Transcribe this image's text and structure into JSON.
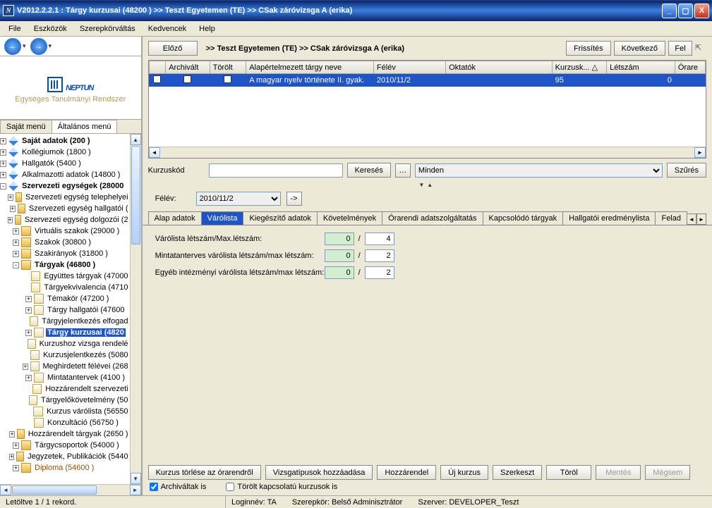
{
  "window": {
    "title": "V2012.2.2.1 : Tárgy kurzusai (48200  )  >> Teszt Egyetemen (TE) >> CSak záróvizsga A (erika)"
  },
  "menu": {
    "items": [
      "File",
      "Eszközök",
      "Szerepkörváltás",
      "Kedvencek",
      "Help"
    ]
  },
  "logo": {
    "main": "NEPTUN",
    "sub": "Egységes Tanulmányi Rendszer"
  },
  "leftTabs": {
    "t0": "Saját menü",
    "t1": "Általános menü"
  },
  "tree": [
    {
      "lvl": 0,
      "tw": "+",
      "ic": "d",
      "lbl": "Saját adatok (200  )",
      "bold": true
    },
    {
      "lvl": 0,
      "tw": "+",
      "ic": "d",
      "lbl": "Kollégiumok (1800  )"
    },
    {
      "lvl": 0,
      "tw": "+",
      "ic": "d",
      "lbl": "Hallgatók (5400  )"
    },
    {
      "lvl": 0,
      "tw": "+",
      "ic": "d",
      "lbl": "Alkalmazotti adatok (14800  )"
    },
    {
      "lvl": 0,
      "tw": "-",
      "ic": "d",
      "lbl": "Szervezeti egységek (28000",
      "bold": true
    },
    {
      "lvl": 1,
      "tw": "+",
      "ic": "f",
      "lbl": "Szervezeti egység telephelyei"
    },
    {
      "lvl": 1,
      "tw": "+",
      "ic": "f",
      "lbl": "Szervezeti egység hallgatói ("
    },
    {
      "lvl": 1,
      "tw": "+",
      "ic": "f",
      "lbl": "Szervezeti egység dolgozói (2"
    },
    {
      "lvl": 1,
      "tw": "+",
      "ic": "f",
      "lbl": "Virtuális szakok (29000  )"
    },
    {
      "lvl": 1,
      "tw": "+",
      "ic": "f",
      "lbl": "Szakok (30800  )"
    },
    {
      "lvl": 1,
      "tw": "+",
      "ic": "f",
      "lbl": "Szakirányok (31800  )"
    },
    {
      "lvl": 1,
      "tw": "-",
      "ic": "f",
      "lbl": "Tárgyak (46800  )",
      "bold": true
    },
    {
      "lvl": 2,
      "tw": " ",
      "ic": "p",
      "lbl": "Együttes tárgyak (47000"
    },
    {
      "lvl": 2,
      "tw": " ",
      "ic": "p",
      "lbl": "Tárgyekvivalencia (4710"
    },
    {
      "lvl": 2,
      "tw": "+",
      "ic": "p",
      "lbl": "Témakör (47200  )"
    },
    {
      "lvl": 2,
      "tw": "+",
      "ic": "p",
      "lbl": "Tárgy hallgatói (47600  "
    },
    {
      "lvl": 2,
      "tw": " ",
      "ic": "p",
      "lbl": "Tárgyjelentkezés elfogad"
    },
    {
      "lvl": 2,
      "tw": "+",
      "ic": "p",
      "lbl": "Tárgy kurzusai (4820",
      "sel": true,
      "bold": true
    },
    {
      "lvl": 2,
      "tw": " ",
      "ic": "p",
      "lbl": "Kurzushoz vizsga rendelé"
    },
    {
      "lvl": 2,
      "tw": " ",
      "ic": "p",
      "lbl": "Kurzusjelentkezés (5080"
    },
    {
      "lvl": 2,
      "tw": "+",
      "ic": "p",
      "lbl": "Meghirdetett félévei (268"
    },
    {
      "lvl": 2,
      "tw": "+",
      "ic": "p",
      "lbl": "Mintatantervek (4100  )"
    },
    {
      "lvl": 2,
      "tw": " ",
      "ic": "p",
      "lbl": "Hozzárendelt szervezeti "
    },
    {
      "lvl": 2,
      "tw": " ",
      "ic": "p",
      "lbl": "Tárgyelőkövetelmény (50"
    },
    {
      "lvl": 2,
      "tw": " ",
      "ic": "p",
      "lbl": "Kurzus várólista (56550  "
    },
    {
      "lvl": 2,
      "tw": " ",
      "ic": "p",
      "lbl": "Konzultáció (56750  )"
    },
    {
      "lvl": 1,
      "tw": "+",
      "ic": "f",
      "lbl": "Hozzárendelt tárgyak (2650  )"
    },
    {
      "lvl": 1,
      "tw": "+",
      "ic": "f",
      "lbl": "Tárgycsoportok (54000  )"
    },
    {
      "lvl": 1,
      "tw": "+",
      "ic": "f",
      "lbl": "Jegyzetek, Publikációk (5440"
    },
    {
      "lvl": 1,
      "tw": "+",
      "ic": "f",
      "lbl": "Diploma (54600  )",
      "brown": true
    }
  ],
  "header": {
    "prev": "Előző",
    "breadcrumb": ">> Teszt Egyetemen (TE) >> CSak záróvizsga A (erika)",
    "refresh": "Frissítés",
    "next": "Következő",
    "up": "Fel"
  },
  "grid": {
    "cols": [
      "",
      "Archivált",
      "Törölt",
      "Alapértelmezett tárgy neve",
      "Félév",
      "Oktatók",
      "Kurzusk... △",
      "Létszám",
      "Órare"
    ],
    "row": {
      "c3": "A magyar nyelv története II. gyak.",
      "c4": "2010/11/2",
      "c5": "",
      "c6": "95",
      "c7": "0"
    }
  },
  "search": {
    "label": "Kurzuskód",
    "btn": "Keresés",
    "filter": "Minden",
    "filterBtn": "Szűrés"
  },
  "felev": {
    "label": "Félév:",
    "value": "2010/11/2"
  },
  "tabs": {
    "items": [
      "Alap adatok",
      "Várólista",
      "Kiegészítő adatok",
      "Követelmények",
      "Órarendi adatszolgáltatás",
      "Kapcsolódó tárgyak",
      "Hallgatói eredménylista",
      "Felad"
    ],
    "activeIndex": 1
  },
  "form": {
    "r0": {
      "label": "Várólista létszám/Max.létszám:",
      "v0": "0",
      "v1": "4"
    },
    "r1": {
      "label": "Mintatanterves várólista létszám/max létszám:",
      "v0": "0",
      "v1": "2"
    },
    "r2": {
      "label": "Egyéb intézményi várólista létszám/max létszám:",
      "v0": "0",
      "v1": "2"
    }
  },
  "bottom": {
    "b0": "Kurzus törlése az órarendről",
    "b1": "Vizsgatípusok hozzáadása",
    "b2": "Hozzárendel",
    "b3": "Új kurzus",
    "b4": "Szerkeszt",
    "b5": "Töröl",
    "b6": "Mentés",
    "b7": "Mégsem",
    "chk0": "Archiváltak is",
    "chk1": "Törölt kapcsolatú kurzusok is"
  },
  "status": {
    "left": "Letöltve 1 / 1 rekord.",
    "login": "Loginnév: TA",
    "role": "Szerepkör: Belső Adminisztrátor",
    "server": "Szerver: DEVELOPER_Teszt"
  }
}
